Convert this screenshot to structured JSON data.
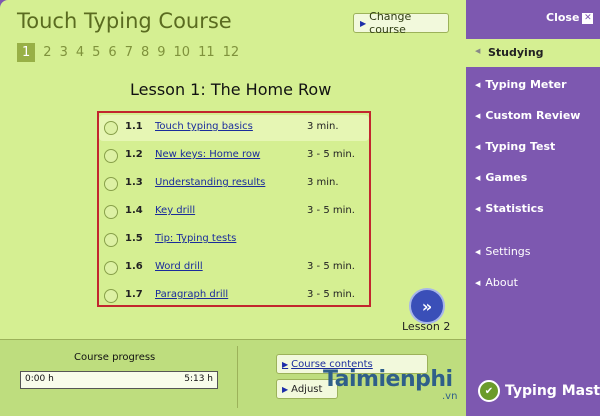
{
  "header": {
    "title": "Touch Typing Course",
    "change_course": "Change course"
  },
  "lesson_numbers": [
    "1",
    "2",
    "3",
    "4",
    "5",
    "6",
    "7",
    "8",
    "9",
    "10",
    "11",
    "12"
  ],
  "lesson": {
    "title": "Lesson 1: The Home Row",
    "items": [
      {
        "num": "1.1",
        "name": "Touch typing basics",
        "duration": "3 min."
      },
      {
        "num": "1.2",
        "name": "New keys: Home row",
        "duration": "3 - 5 min."
      },
      {
        "num": "1.3",
        "name": "Understanding results",
        "duration": "3 min."
      },
      {
        "num": "1.4",
        "name": "Key drill",
        "duration": "3 - 5 min."
      },
      {
        "num": "1.5",
        "name": "Tip: Typing tests",
        "duration": ""
      },
      {
        "num": "1.6",
        "name": "Word drill",
        "duration": "3 - 5 min."
      },
      {
        "num": "1.7",
        "name": "Paragraph drill",
        "duration": "3 - 5 min."
      }
    ],
    "next_label": "Lesson 2"
  },
  "progress": {
    "label": "Course progress",
    "start": "0:00 h",
    "end": "5:13 h",
    "fraction": 0
  },
  "bottom": {
    "course_contents": "Course contents",
    "adjust": "Adjust"
  },
  "watermark": {
    "text": "Taimienphi",
    "suffix": ".vn"
  },
  "sidebar": {
    "close": "Close",
    "items": [
      "Studying",
      "Typing Meter",
      "Custom Review",
      "Typing Test",
      "Games",
      "Statistics",
      "Settings",
      "About"
    ]
  },
  "logo": {
    "text": "Typing Master"
  },
  "colors": {
    "main_bg": "#d5ef92",
    "sidebar_bg": "#7d58b0",
    "highlight_border": "#c2262e",
    "link": "#1a2c9c"
  }
}
